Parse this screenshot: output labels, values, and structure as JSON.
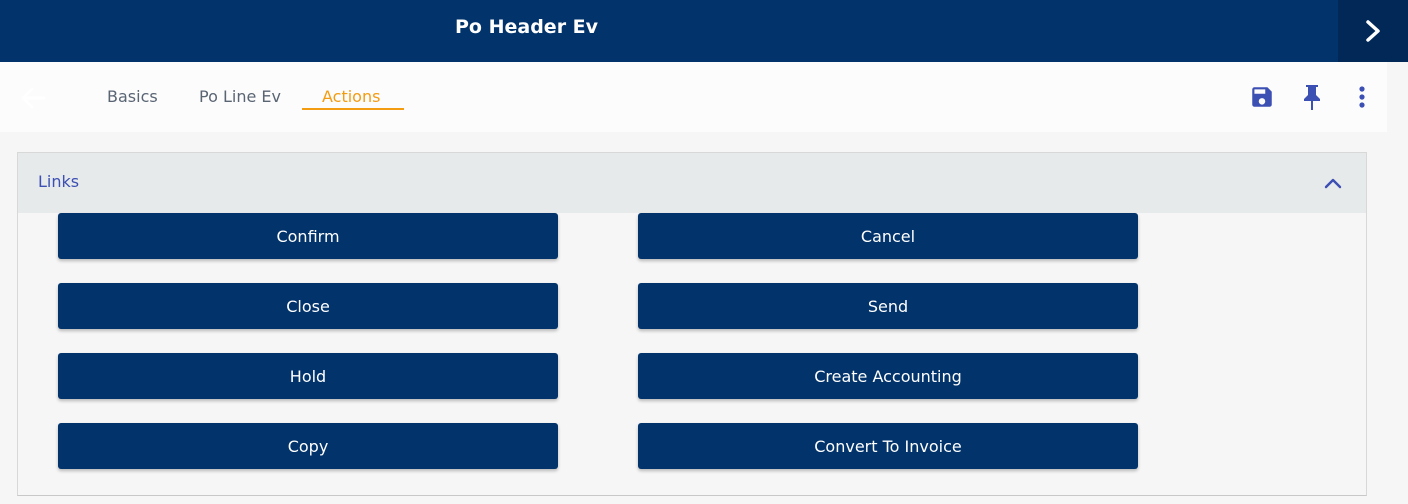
{
  "header": {
    "title": "Po Header Ev",
    "expand_icon": "chevron-right-icon"
  },
  "tabs": {
    "back_icon": "arrow-left-icon",
    "items": [
      {
        "label": "Basics",
        "active": false
      },
      {
        "label": "Po Line Ev",
        "active": false
      },
      {
        "label": "Actions",
        "active": true
      }
    ],
    "active_color": "#f39c12"
  },
  "toolbar": {
    "icons": [
      "save-icon",
      "pin-icon",
      "more-vert-icon"
    ],
    "icon_color": "#3c4fb3"
  },
  "links_panel": {
    "title": "Links",
    "collapse_icon": "chevron-up-icon",
    "buttons": [
      {
        "label": "Confirm"
      },
      {
        "label": "Cancel"
      },
      {
        "label": "Close"
      },
      {
        "label": "Send"
      },
      {
        "label": "Hold"
      },
      {
        "label": "Create Accounting"
      },
      {
        "label": "Copy"
      },
      {
        "label": "Convert To Invoice"
      }
    ]
  },
  "colors": {
    "primary": "#02336b",
    "accent": "#f39c12",
    "link_text": "#3c4fb3"
  }
}
